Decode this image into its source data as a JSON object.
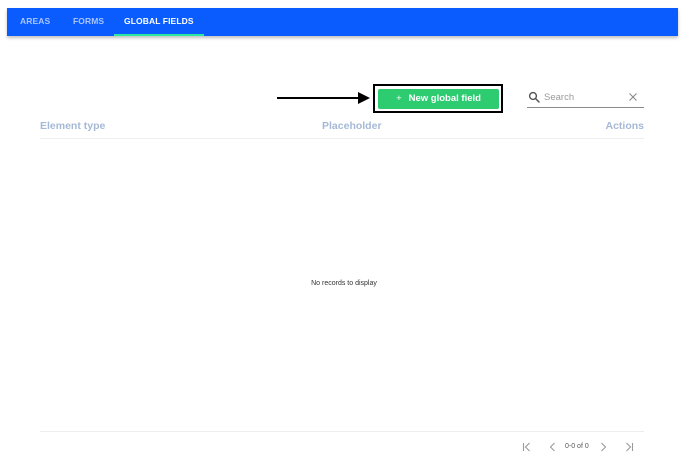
{
  "nav": {
    "tabs": [
      {
        "label": "AREAS"
      },
      {
        "label": "FORMS"
      },
      {
        "label": "GLOBAL FIELDS"
      }
    ],
    "active_tab": "GLOBAL FIELDS"
  },
  "toolbar": {
    "new_button_label": "New global field",
    "new_button_icon": "plus-icon",
    "search_placeholder": "Search",
    "search_value": "",
    "button_color": "#2ecc71"
  },
  "table": {
    "columns": [
      "Element type",
      "Placeholder",
      "Actions"
    ],
    "rows": [],
    "empty_message": "No records to display"
  },
  "pagination": {
    "info": "0-0 of 0",
    "icons": [
      "first-page-icon",
      "previous-page-icon",
      "next-page-icon",
      "last-page-icon"
    ]
  },
  "colors": {
    "topbar": "#0a5cff",
    "active_tab_indicator": "#2ee7a3",
    "header_text": "#a5b9d6"
  }
}
